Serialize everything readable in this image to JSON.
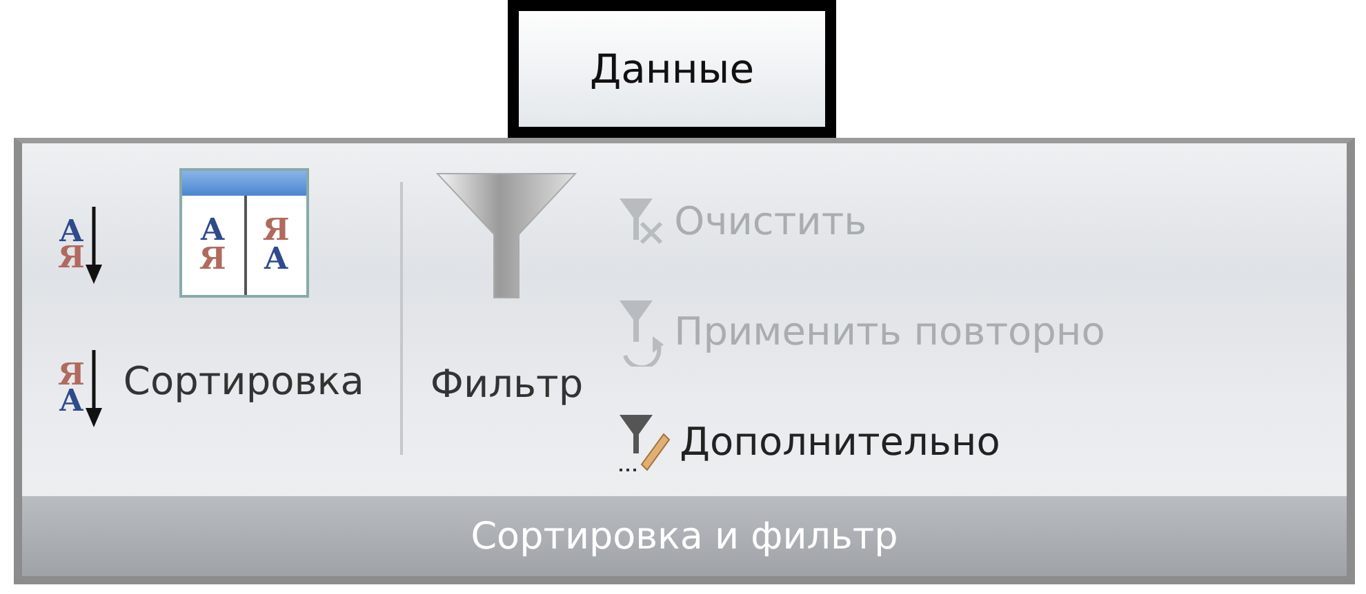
{
  "tab": {
    "label": "Данные",
    "selected": true
  },
  "group": {
    "label": "Сортировка и фильтр",
    "sort_ascending": {
      "letters": [
        "А",
        "Я"
      ]
    },
    "sort_descending": {
      "letters": [
        "Я",
        "А"
      ]
    },
    "sort": {
      "label": "Сортировка",
      "icon_letters": [
        [
          "А",
          "Я"
        ],
        [
          "Я",
          "А"
        ]
      ]
    },
    "filter": {
      "label": "Фильтр"
    },
    "commands": [
      {
        "kind": "clear",
        "label": "Очистить",
        "disabled": true
      },
      {
        "kind": "reapply",
        "label": "Применить повторно",
        "disabled": true
      },
      {
        "kind": "advanced",
        "label": "Дополнительно",
        "disabled": false
      }
    ]
  }
}
